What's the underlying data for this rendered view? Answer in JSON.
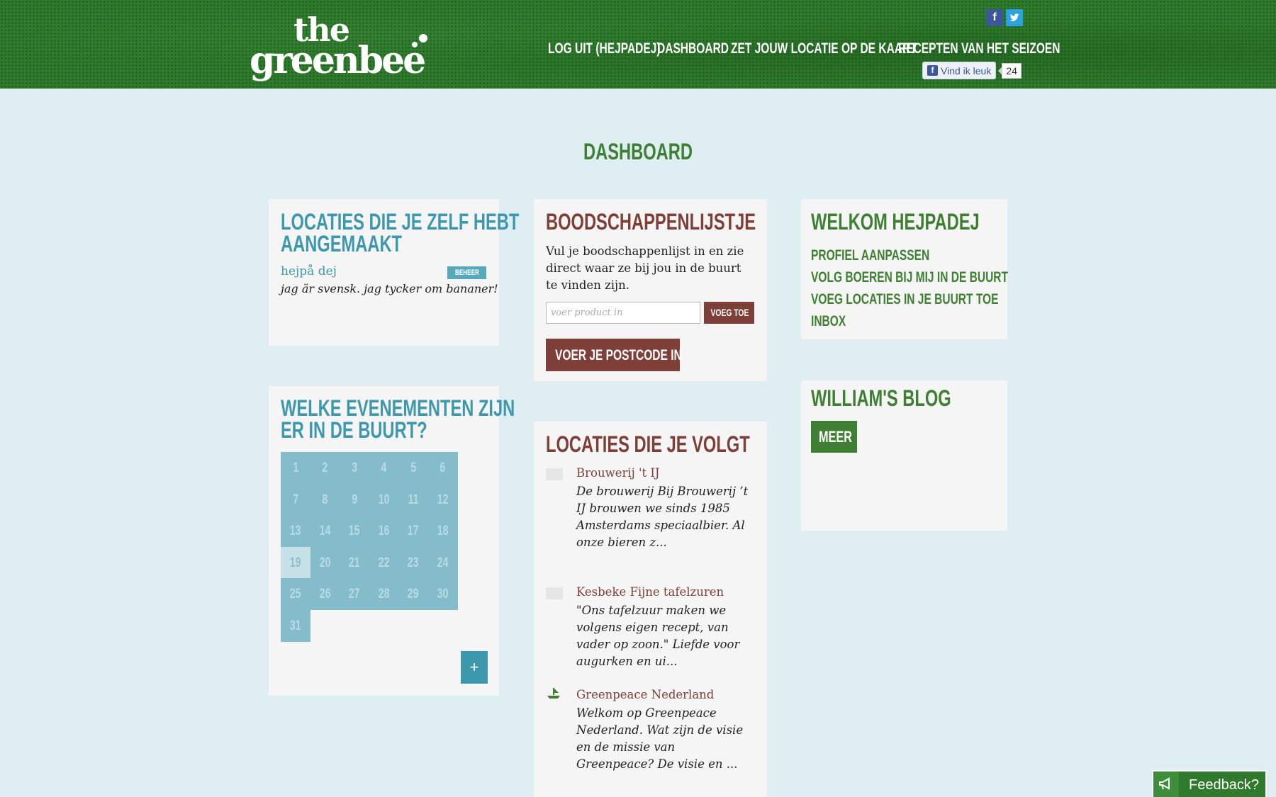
{
  "header": {
    "logo_line1": "the",
    "logo_line2": "greenbee",
    "nav": [
      {
        "label": "LOG UIT (HEJPADEJ)"
      },
      {
        "label": "DASHBOARD"
      },
      {
        "label": "ZET JOUW LOCATIE OP DE KAART"
      },
      {
        "label": "RECEPTEN VAN HET SEIZOEN"
      }
    ],
    "social": {
      "facebook_icon": "f",
      "twitter_icon": "t"
    },
    "like": {
      "f_icon": "f",
      "label": "Vind ik leuk",
      "count": "24"
    }
  },
  "page": {
    "title": "DASHBOARD"
  },
  "own_locations": {
    "title_line1": "LOCATIES DIE JE ZELF HEBT",
    "title_line2": "AANGEMAAKT",
    "items": [
      {
        "name": "hejpå dej",
        "badge": "BEHEER",
        "description": "jag är svensk. jag tycker om bananer!"
      }
    ]
  },
  "events": {
    "title_line1": "WELKE EVENEMENTEN ZIJN",
    "title_line2": "ER IN DE BUURT?",
    "days": [
      "1",
      "2",
      "3",
      "4",
      "5",
      "6",
      "7",
      "8",
      "9",
      "10",
      "11",
      "12",
      "13",
      "14",
      "15",
      "16",
      "17",
      "18",
      "19",
      "20",
      "21",
      "22",
      "23",
      "24",
      "25",
      "26",
      "27",
      "28",
      "29",
      "30",
      "31"
    ],
    "today": "19",
    "add_label": "+"
  },
  "shopping": {
    "title": "BOODSCHAPPENLIJSTJE",
    "text": "Vul je boodschappenlijst in en zie direct waar ze bij jou in de buurt te vinden zijn.",
    "input_placeholder": "voer product in",
    "add_label": "VOEG TOE",
    "zip_label": "VOER JE POSTCODE IN"
  },
  "followed": {
    "title": "LOCATIES DIE JE VOLGT",
    "items": [
      {
        "name": "Brouwerij 't IJ",
        "description": "De brouwerij Bij Brouwerij ’t IJ brouwen we sinds 1985 Amsterdams speciaalbier. Al onze bieren z..."
      },
      {
        "name": "Kesbeke Fijne tafelzuren",
        "description": "\"Ons tafelzuur maken we volgens eigen recept, van vader op zoon.\" Liefde voor augurken en ui..."
      },
      {
        "name": "Greenpeace Nederland",
        "description": "Welkom op Greenpeace Nederland. Wat zijn de visie en de missie van Greenpeace? De visie en ..."
      }
    ]
  },
  "welcome": {
    "title": "WELKOM HEJPADEJ",
    "links": [
      "PROFIEL AANPASSEN",
      "VOLG BOEREN BIJ MIJ IN DE BUURT",
      "VOEG LOCATIES IN JE BUURT TOE",
      "INBOX"
    ]
  },
  "blog": {
    "title": "WILLIAM'S BLOG",
    "more_label": "MEER"
  },
  "feedback": {
    "label": "Feedback?",
    "icon": "megaphone-icon"
  },
  "colors": {
    "header_green": "#2f7a2c",
    "blue": "#3d98ae",
    "brown": "#7d3f37",
    "green": "#3f7f33",
    "background": "#deeef2"
  }
}
